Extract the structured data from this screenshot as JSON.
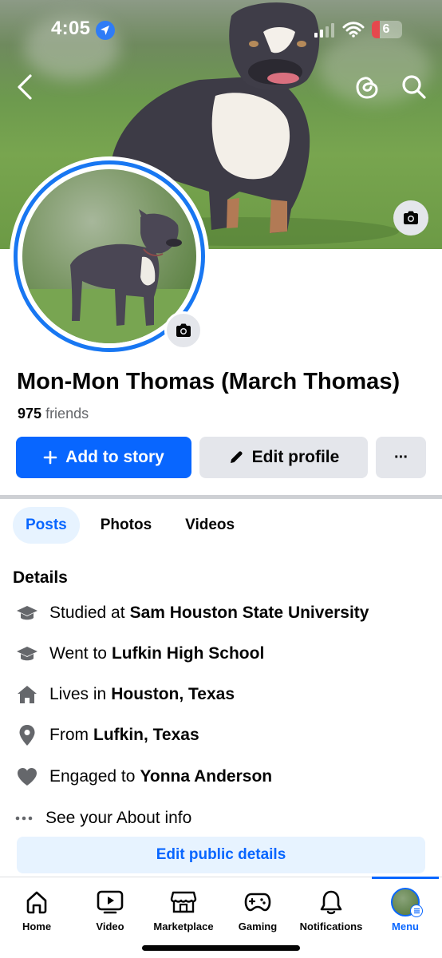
{
  "status_bar": {
    "time": "4:05",
    "battery": "6"
  },
  "profile": {
    "name": "Mon-Mon Thomas (March Thomas)",
    "friends_count": "975",
    "friends_label": "friends"
  },
  "actions": {
    "add_to_story": "Add to story",
    "edit_profile": "Edit profile",
    "more": "···"
  },
  "tabs": [
    {
      "label": "Posts",
      "active": true
    },
    {
      "label": "Photos",
      "active": false
    },
    {
      "label": "Videos",
      "active": false
    }
  ],
  "details": {
    "title": "Details",
    "items": [
      {
        "icon": "graduation-cap-icon",
        "prefix": "Studied at",
        "value": "Sam Houston State University"
      },
      {
        "icon": "graduation-cap-icon",
        "prefix": "Went to",
        "value": "Lufkin High School"
      },
      {
        "icon": "house-icon",
        "prefix": "Lives in",
        "value": "Houston, Texas"
      },
      {
        "icon": "location-pin-icon",
        "prefix": "From",
        "value": "Lufkin, Texas"
      },
      {
        "icon": "heart-icon",
        "prefix": "Engaged to",
        "value": "Yonna Anderson"
      }
    ],
    "see_about": "See your About info",
    "edit_public": "Edit public details"
  },
  "nav": [
    {
      "label": "Home",
      "icon": "home-icon"
    },
    {
      "label": "Video",
      "icon": "video-icon"
    },
    {
      "label": "Marketplace",
      "icon": "marketplace-icon"
    },
    {
      "label": "Gaming",
      "icon": "gaming-icon"
    },
    {
      "label": "Notifications",
      "icon": "bell-icon"
    },
    {
      "label": "Menu",
      "icon": "menu-avatar-icon",
      "active": true
    }
  ],
  "colors": {
    "accent": "#0866ff",
    "ring": "#1877f2",
    "tab_bg": "#e7f3ff"
  }
}
